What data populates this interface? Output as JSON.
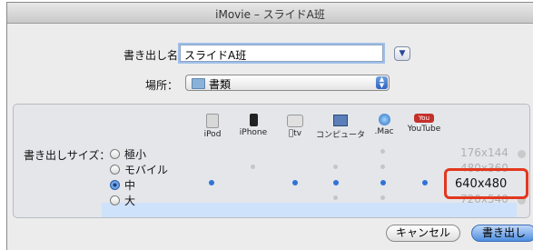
{
  "window": {
    "title": "iMovie – スライドA班"
  },
  "export_name": {
    "label": "書き出し名：",
    "value": "スライドA班"
  },
  "location": {
    "label": "場所：",
    "value": "書類"
  },
  "size_section": {
    "label": "書き出しサイズ：",
    "devices": [
      {
        "name": "iPod",
        "icon": "ipod-icon"
      },
      {
        "name": "iPhone",
        "icon": "iphone-icon"
      },
      {
        "name": "tv",
        "icon": "apple-tv-icon"
      },
      {
        "name": "コンピュータ",
        "icon": "computer-icon"
      },
      {
        "name": ".Mac",
        "icon": "dotmac-icon"
      },
      {
        "name": "YouTube",
        "icon": "youtube-icon"
      }
    ],
    "youtube_logo_text": "You Tube",
    "sizes": [
      {
        "label": "極小",
        "resolution": "176x144",
        "selected": false,
        "targets": [
          false,
          false,
          false,
          false,
          true,
          false
        ]
      },
      {
        "label": "モバイル",
        "resolution": "480x360",
        "selected": false,
        "targets": [
          false,
          true,
          false,
          true,
          true,
          false
        ]
      },
      {
        "label": "中",
        "resolution": "640x480",
        "selected": true,
        "targets": [
          true,
          false,
          true,
          true,
          true,
          true
        ]
      },
      {
        "label": "大",
        "resolution": "720x540",
        "selected": false,
        "targets": [
          false,
          false,
          false,
          true,
          true,
          false
        ]
      }
    ]
  },
  "buttons": {
    "cancel": "キャンセル",
    "export": "書き出し"
  },
  "colors": {
    "highlight_box": "#e3371e",
    "selected_row": "#cfe2fb",
    "dot_active": "#2f74d6"
  }
}
